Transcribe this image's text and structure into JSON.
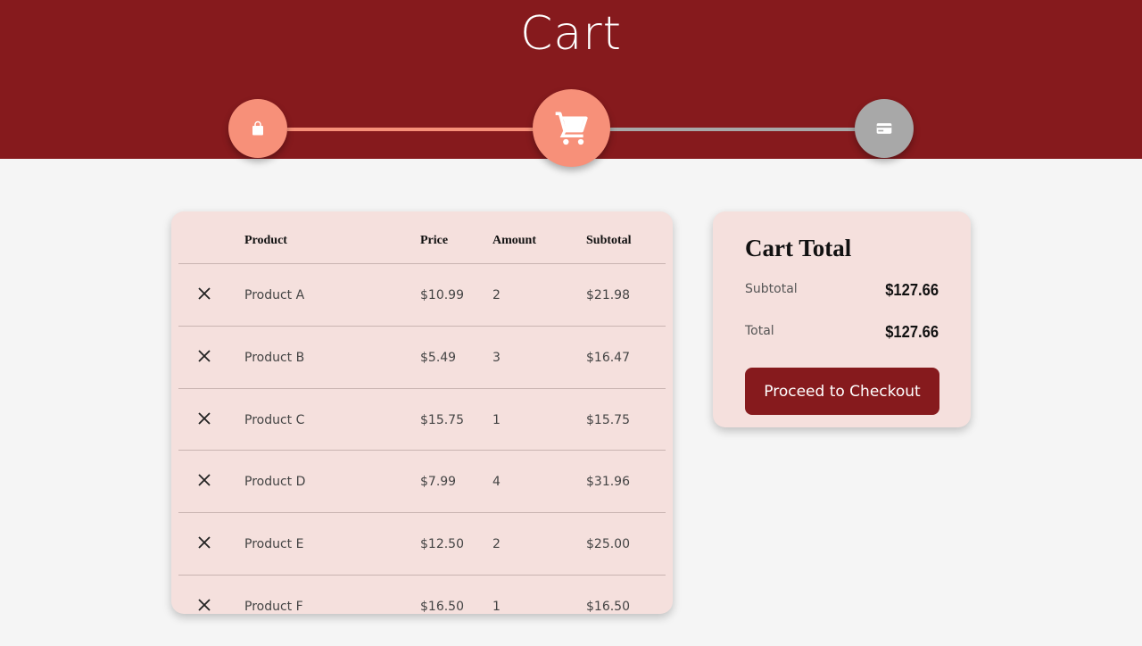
{
  "header": {
    "title": "Cart",
    "steps": [
      {
        "icon": "shopping-bag-icon",
        "state": "done"
      },
      {
        "icon": "shopping-cart-icon",
        "state": "current"
      },
      {
        "icon": "credit-card-icon",
        "state": "pending"
      }
    ]
  },
  "cart_table": {
    "headers": {
      "product": "Product",
      "price": "Price",
      "amount": "Amount",
      "subtotal": "Subtotal"
    },
    "rows": [
      {
        "product": "Product A",
        "price": "$10.99",
        "amount": "2",
        "subtotal": "$21.98"
      },
      {
        "product": "Product B",
        "price": "$5.49",
        "amount": "3",
        "subtotal": "$16.47"
      },
      {
        "product": "Product C",
        "price": "$15.75",
        "amount": "1",
        "subtotal": "$15.75"
      },
      {
        "product": "Product D",
        "price": "$7.99",
        "amount": "4",
        "subtotal": "$31.96"
      },
      {
        "product": "Product E",
        "price": "$12.50",
        "amount": "2",
        "subtotal": "$25.00"
      },
      {
        "product": "Product F",
        "price": "$16.50",
        "amount": "1",
        "subtotal": "$16.50"
      }
    ]
  },
  "cart_total": {
    "title": "Cart Total",
    "subtotal_label": "Subtotal",
    "subtotal_value": "$127.66",
    "total_label": "Total",
    "total_value": "$127.66",
    "checkout_label": "Proceed to Checkout"
  },
  "colors": {
    "brand": "#861a1d",
    "accent": "#f79079",
    "inactive": "#a8a8a8",
    "panel": "#f5e0dd",
    "background": "#f5f5f5"
  }
}
